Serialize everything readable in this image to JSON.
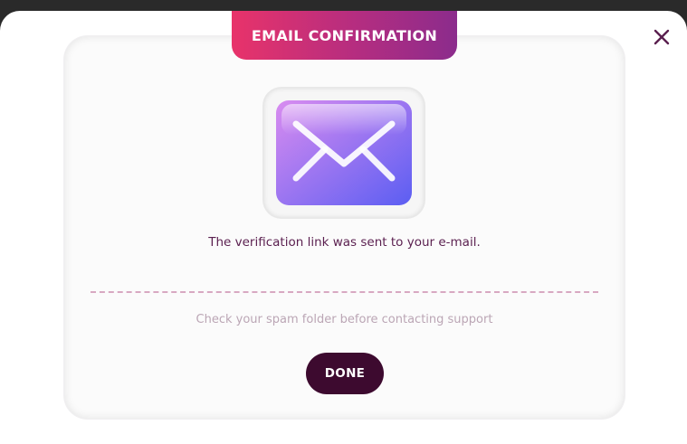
{
  "dialog": {
    "title": "EMAIL CONFIRMATION",
    "message": "The verification link was sent to your e-mail.",
    "hint": "Check your spam folder before contacting support",
    "done_label": "DONE",
    "close_icon": "close-icon",
    "main_icon": "envelope-icon"
  },
  "colors": {
    "title_gradient_start": "#e8336a",
    "title_gradient_end": "#8b2c8c",
    "message_text": "#5a1f4f",
    "hint_text": "#bba6b5",
    "done_button": "#3d0a2f",
    "close_icon": "#5a1f4f",
    "envelope_gradient_start": "#d98cf0",
    "envelope_gradient_end": "#5b5ef2",
    "divider": "#d8a8c2"
  }
}
